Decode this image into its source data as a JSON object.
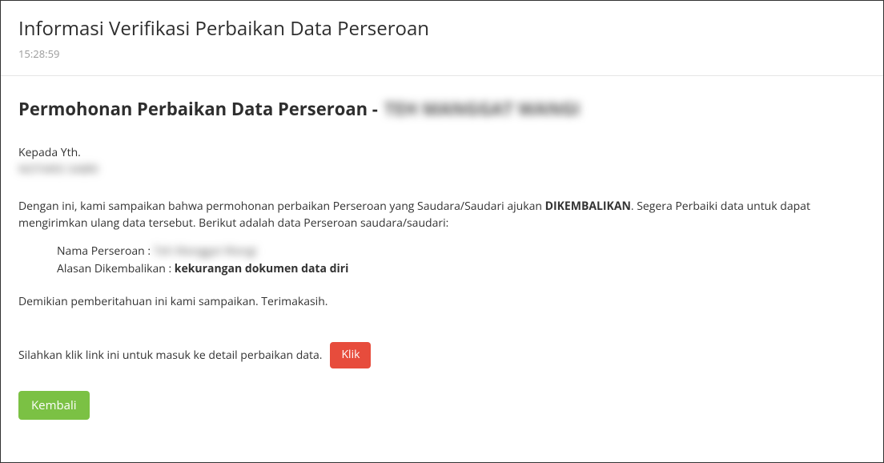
{
  "header": {
    "title": "Informasi Verifikasi Perbaikan Data Perseroan",
    "timestamp": "15:28:59"
  },
  "request": {
    "heading_prefix": "Permohonan Perbaikan Data Perseroan - ",
    "company_name_masked": "TEH MANGGAT WANGI"
  },
  "salutation": "Kepada Yth.",
  "recipient_masked": "NOTARIS SABRI",
  "body": {
    "para1_prefix": "Dengan ini, kami sampaikan bahwa permohonan perbaikan Perseroan yang Saudara/Saudari ajukan ",
    "status_word": "DIKEMBALIKAN",
    "para1_suffix": ". Segera Perbaiki data untuk dapat mengirimkan ulang data tersebut. Berikut adalah data Perseroan saudara/saudari:"
  },
  "meta": {
    "company_label": "Nama Perseroan : ",
    "company_value_masked": "Teh Manggat Wangi",
    "reason_label": "Alasan Dikembalikan : ",
    "reason_value": "kekurangan dokumen data diri"
  },
  "closing": "Demikian pemberitahuan ini kami sampaikan. Terimakasih.",
  "action": {
    "link_text": "Silahkan klik link ini untuk masuk ke detail perbaikan data.",
    "klik_label": "Klik"
  },
  "buttons": {
    "back_label": "Kembali"
  }
}
